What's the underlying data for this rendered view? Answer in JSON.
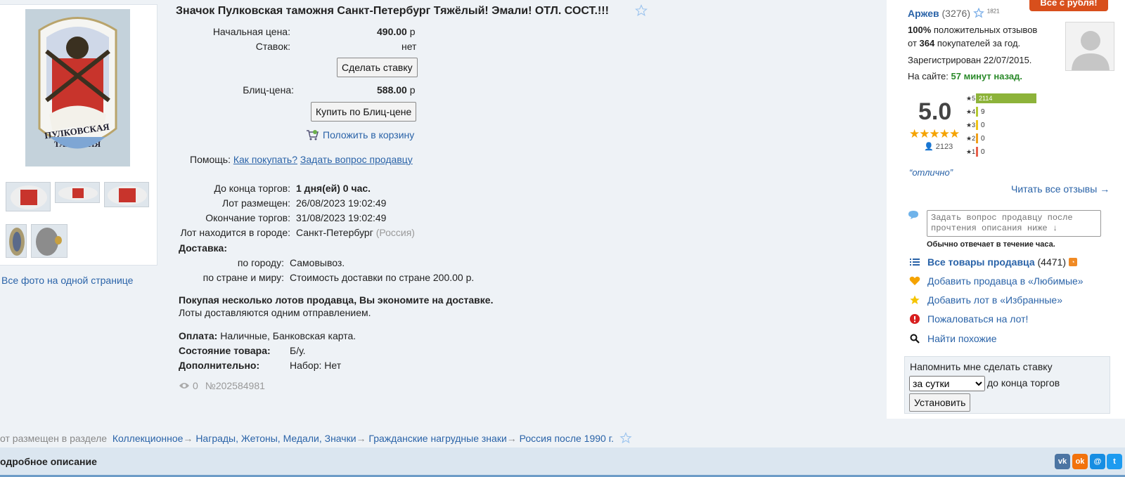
{
  "lot": {
    "title": "Значок Пулковская таможня Санкт-Петербург Тяжёлый! Эмали! ОТЛ. СОСТ.!!!",
    "start_price_label": "Начальная цена:",
    "start_price_value": "490.00",
    "currency": "р",
    "bids_label": "Ставок:",
    "bids_value": "нет",
    "bid_button": "Сделать ставку",
    "blitz_label": "Блиц-цена:",
    "blitz_value": "588.00",
    "blitz_button": "Купить по Блиц-цене",
    "cart_link": "Положить в корзину",
    "help_label": "Помощь:",
    "help_link1": "Как покупать?",
    "help_link2": "Задать вопрос продавцу",
    "ends_in_label": "До конца торгов:",
    "ends_in_value": "1 дня(ей) 0 час.",
    "placed_label": "Лот размещен:",
    "placed_value": "26/08/2023 19:02:49",
    "end_label": "Окончание торгов:",
    "end_value": "31/08/2023 19:02:49",
    "city_label": "Лот находится в городе:",
    "city_value": "Санкт-Петербург",
    "country_value": "(Россия)",
    "delivery_label": "Доставка:",
    "delivery_city_label": "по городу:",
    "delivery_city_value": "Самовывоз.",
    "delivery_world_label": "по стране и миру:",
    "delivery_world_value": "Стоимость доставки по стране 200.00 р.",
    "save_note_bold": "Покупая несколько лотов продавца, Вы экономите на доставке.",
    "save_note": "Лоты доставляются одним отправлением.",
    "payment_label": "Оплата:",
    "payment_value": "Наличные, Банковская карта.",
    "condition_label": "Состояние товара:",
    "condition_value": "Б/у.",
    "extra_label": "Дополнительно:",
    "extra_value": "Набор: Нет",
    "views": "0",
    "lot_number": "№202584981"
  },
  "gallery": {
    "all_photos_link": "Все фото на одной странице"
  },
  "seller": {
    "promo_tab": "Все с рубля!",
    "name": "Аржев",
    "score": "(3276)",
    "stars_count": "1821",
    "positive_pct": "100%",
    "positive_text": "положительных отзывов",
    "buyers_pre": "от",
    "buyers_count": "364",
    "buyers_post": "покупателей за год.",
    "registered": "Зарегистрирован 22/07/2015.",
    "online_label": "На сайте:",
    "online_value": "57 минут назад.",
    "rating": "5.0",
    "stars": "★★★★★",
    "reviewers": "2123",
    "histogram": [
      {
        "star": "5",
        "count": "2114",
        "color": "#8db33a"
      },
      {
        "star": "4",
        "count": "9",
        "color": "#b5c932"
      },
      {
        "star": "3",
        "count": "0",
        "color": "#f0c419"
      },
      {
        "star": "2",
        "count": "0",
        "color": "#f0a019"
      },
      {
        "star": "1",
        "count": "0",
        "color": "#e8604c"
      }
    ],
    "quote": "“отлично”",
    "read_reviews": "Читать все отзывы →",
    "question_placeholder": "Задать вопрос продавцу после прочтения описания ниже ↓",
    "reply_time": "Обычно отвечает в течение часа.",
    "all_items_label": "Все товары продавца",
    "all_items_count": "(4471)",
    "add_favorite_seller": "Добавить продавца в «Любимые»",
    "add_favorite_lot": "Добавить лот в «Избранные»",
    "report": "Пожаловаться на лот!",
    "find_similar": "Найти похожие",
    "remind_label": "Напомнить мне сделать ставку",
    "remind_option": "за сутки",
    "remind_suffix": "до конца торгов",
    "remind_button": "Установить"
  },
  "breadcrumb": {
    "prefix": "от размещен в разделе",
    "c1": "Коллекционное",
    "c2": "Награды, Жетоны, Медали, Значки",
    "c3": "Гражданские нагрудные знаки",
    "c4": "Россия после 1990 г."
  },
  "description": {
    "title": "одробное описание"
  },
  "colors": {
    "link": "#2a63a8",
    "online_green": "#2a8a2a",
    "promo": "#d84f1c"
  }
}
